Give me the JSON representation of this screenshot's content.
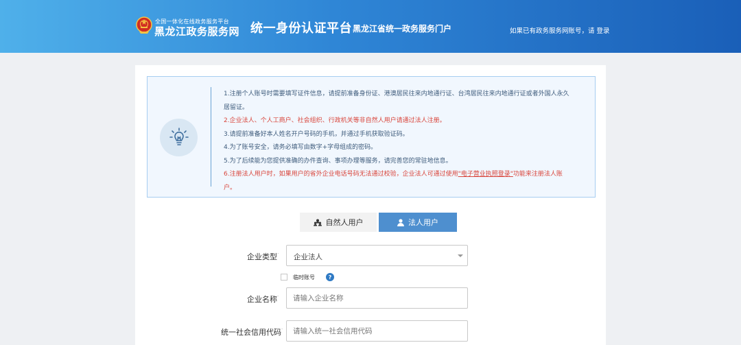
{
  "header": {
    "brand_small": "全国一体化在线政务服务平台",
    "brand_big": "黑龙江政务服务网",
    "platform_title": "统一身份认证平台",
    "platform_sub": "黑龙江省统一政务服务门户",
    "login_prompt": "如果已有政务服务网账号，请",
    "login_link": "登录"
  },
  "notice": {
    "icon": "lightbulb-icon",
    "line1": "1.注册个人账号时需要填写证件信息，请提前准备身份证、港澳居民往来内地通行证、台湾居民往来内地通行证或者外国人永久居留证。",
    "line2": "2.企业法人、个人工商户、社会组织、行政机关等非自然人用户请通过法人注册。",
    "line3": "3.请提前准备好本人姓名开户号码的手机，并通过手机获取验证码。",
    "line4": "4.为了账号安全，请务必填写由数字+字母组成的密码。",
    "line5": "5.为了后续能为您提供准确的办件查询、事项办理等服务，请完善您的常驻地信息。",
    "line6_pre": "6.注册法人用户时，如果用户的省外企业电话号码无法通过校验，企业法人可通过使用",
    "line6_link": "\"电子营业执照登录\"",
    "line6_post": "功能来注册法人账户。",
    "warn_color": "#d9453b"
  },
  "tabs": {
    "natural": "自然人用户",
    "legal": "法人用户",
    "active": "legal",
    "active_color": "#4e8fcf"
  },
  "form": {
    "type_label": "企业类型",
    "type_value": "企业法人",
    "temp_label": "临时账号",
    "help": "?",
    "name_label": "企业名称",
    "name_placeholder": "请输入企业名称",
    "code_label": "统一社会信用代码",
    "code_placeholder": "请输入统一社会信用代码",
    "required_mark": "·"
  }
}
